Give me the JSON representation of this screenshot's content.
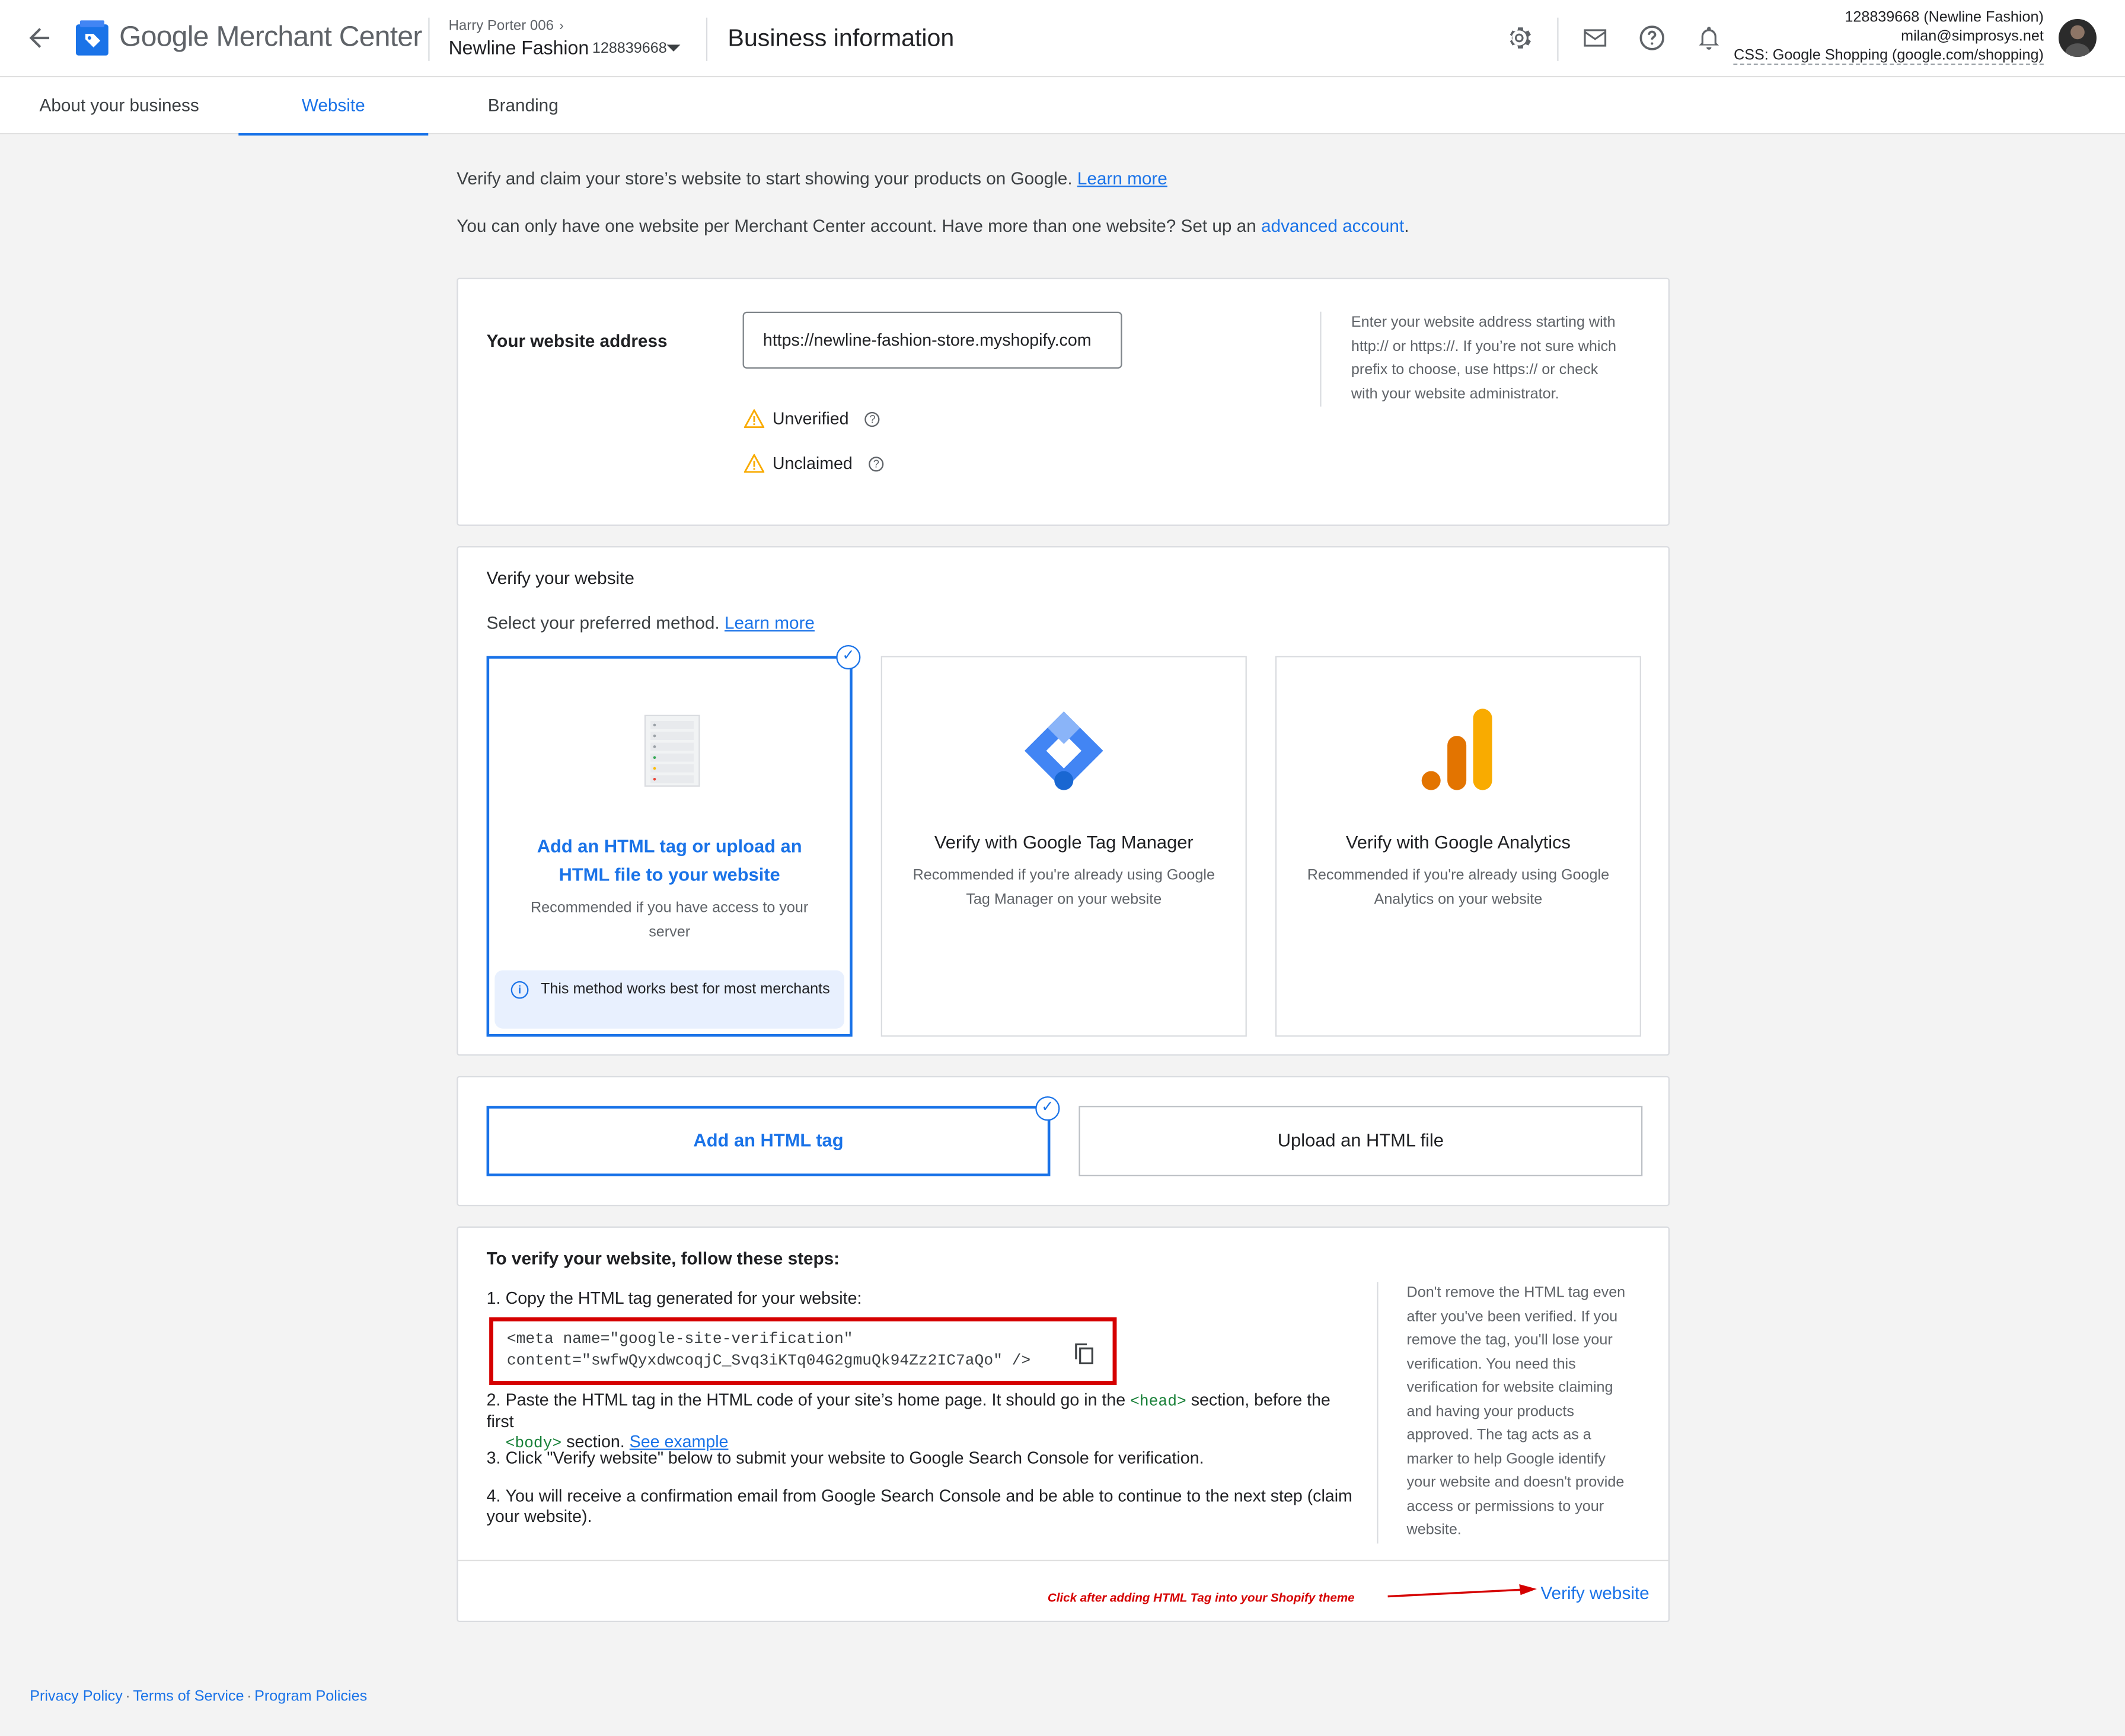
{
  "header": {
    "brand_google": "Google",
    "brand_product": "Merchant Center",
    "account_owner": "Harry Porter 006",
    "account_name": "Newline Fashion",
    "account_id": "128839668",
    "page_title": "Business information",
    "user_account": "128839668 (Newline Fashion)",
    "user_email": "milan@simprosys.net",
    "user_css": "CSS: Google Shopping (google.com/shopping)"
  },
  "tabs": [
    {
      "label": "About your business"
    },
    {
      "label": "Website"
    },
    {
      "label": "Branding"
    }
  ],
  "intro": {
    "line1": "Verify and claim your store’s website to start showing your products on Google.",
    "line1_link": "Learn more",
    "line2": "You can only have one website per Merchant Center account. Have more than one website? Set up an",
    "line2_link": "advanced account",
    "line2_end": "."
  },
  "website": {
    "label": "Your website address",
    "url": "https://newline-fashion-store.myshopify.com",
    "status_unverified": "Unverified",
    "status_unclaimed": "Unclaimed",
    "note": "Enter your website address starting with http:// or https://. If you’re not sure which prefix to choose, use https:// or check with your website administrator."
  },
  "verify": {
    "title": "Verify your website",
    "subtitle": "Select your preferred method.",
    "subtitle_link": "Learn more",
    "methods": [
      {
        "title": "Add an HTML tag or upload an HTML file to your website",
        "desc": "Recommended if you have access to your server",
        "info": "This method works best for most merchants"
      },
      {
        "title": "Verify with Google Tag Manager",
        "desc": "Recommended if you're already using Google Tag Manager on your website"
      },
      {
        "title": "Verify with Google Analytics",
        "desc": "Recommended if you're already using Google Analytics on your website"
      }
    ]
  },
  "options": {
    "tag": "Add an HTML tag",
    "file": "Upload an HTML file"
  },
  "steps": {
    "title": "To verify your website, follow these steps:",
    "s1": "Copy the HTML tag generated for your website:",
    "code_line1": "<meta name=\"google-site-verification\"",
    "code_line2": "content=\"swfwQyxdwcoqjC_Svq3iKTq04G2gmuQk94Zz2IC7aQo\" />",
    "s2_a": "Paste the HTML tag in the HTML code of your site’s home page. It should go in the",
    "s2_head": "<head>",
    "s2_b": "section, before the first",
    "s2_body": "<body>",
    "s2_c": "section.",
    "s2_link": "See example",
    "s3": "Click \"Verify website\" below to submit your website to Google Search Console for verification.",
    "s4": "You will receive a confirmation email from Google Search Console and be able to continue to the next step (claim your website).",
    "note": "Don't remove the HTML tag even after you've been verified. If you remove the tag, you'll lose your verification. You need this verification for website claiming and having your products approved. The tag acts as a marker to help Google identify your website and doesn't provide access or permissions to your website.",
    "annotation": "Click after adding HTML Tag into your Shopify theme",
    "verify_button": "Verify website"
  },
  "footer": {
    "privacy": "Privacy Policy",
    "terms": "Terms of Service",
    "policies": "Program Policies"
  },
  "colors": {
    "accent": "#1a73e8",
    "warning": "#f9ab00",
    "annotation": "#d50000"
  }
}
